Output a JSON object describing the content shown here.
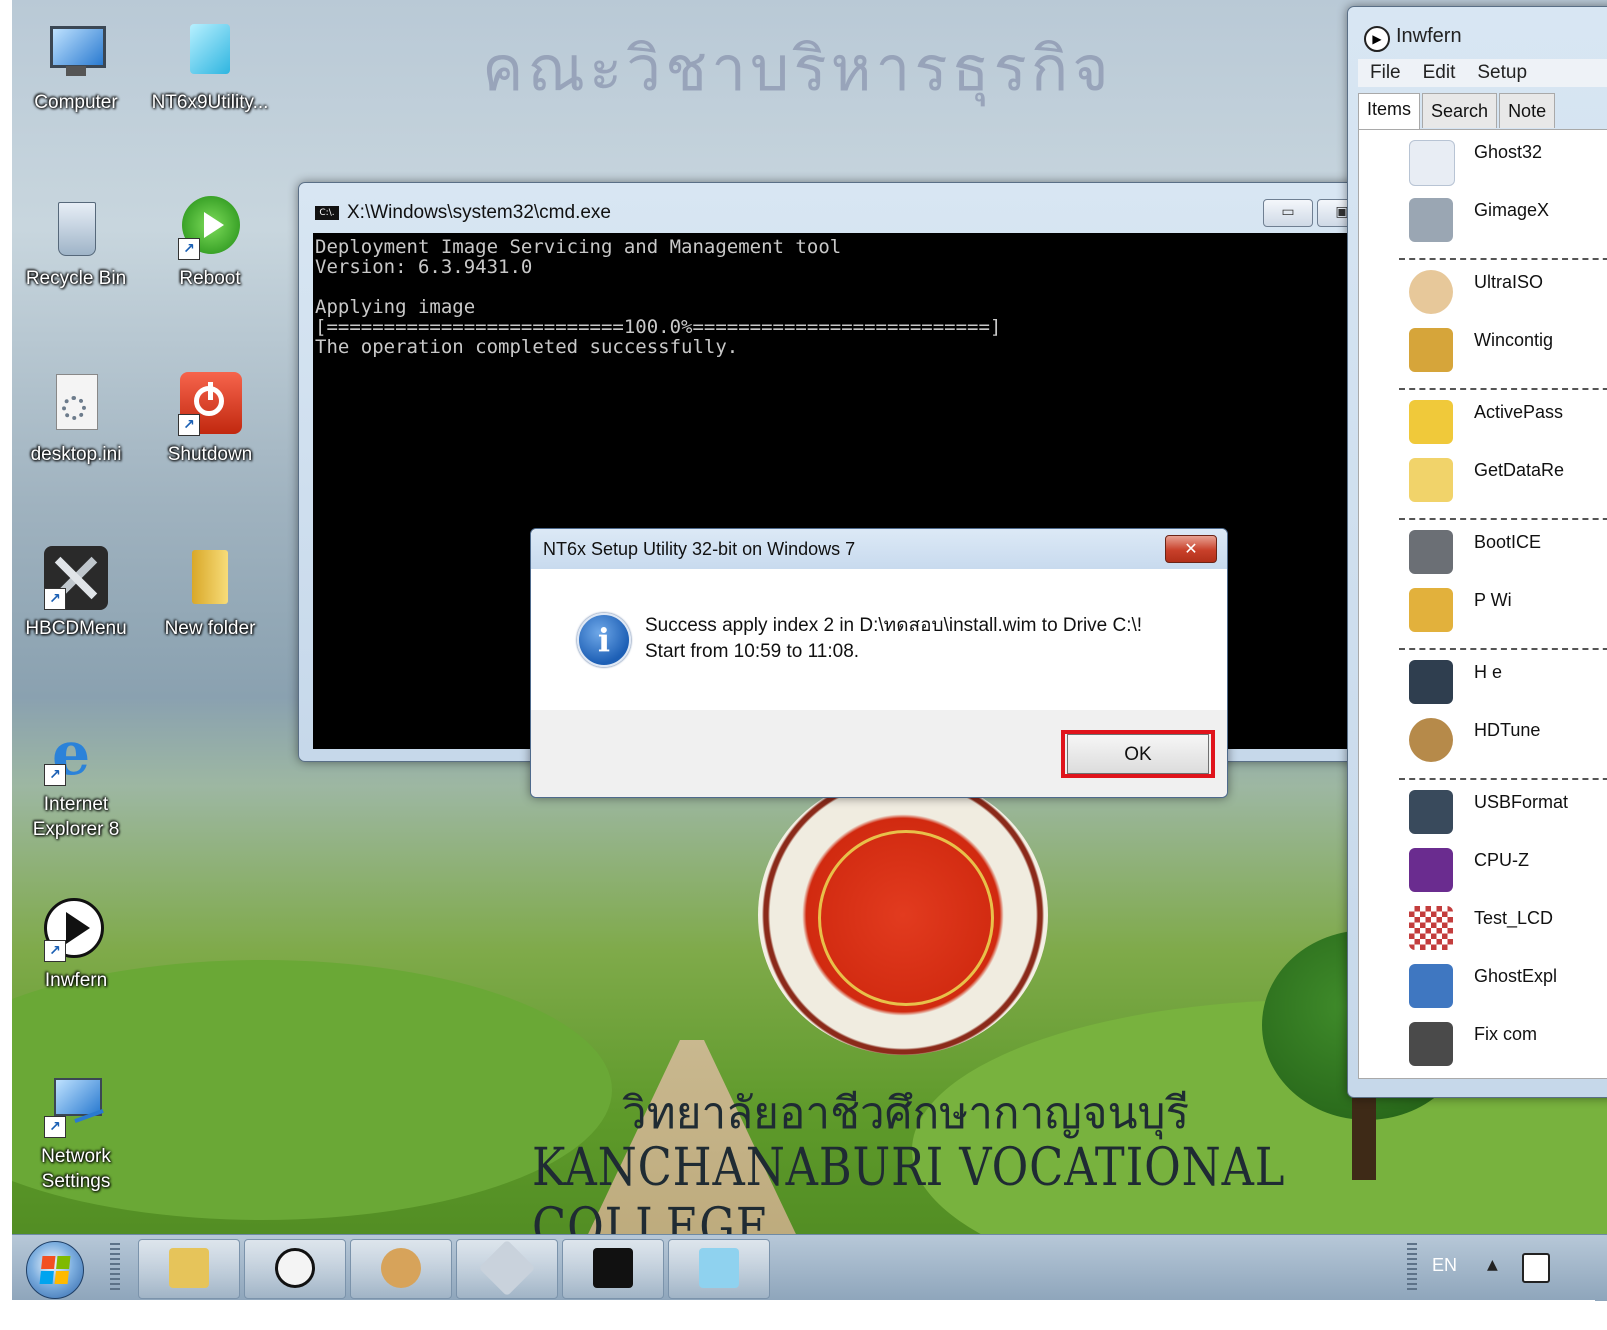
{
  "desktop": {
    "banner_text": "คณะวิชาบริหารธุรกิจ",
    "college_th": "วิทยาลัยอาชีวศึกษากาญจนบุรี",
    "college_en": "KANCHANABURI VOCATIONAL COLLEGE",
    "icons": [
      {
        "label": "Computer",
        "icon": "computer-icon"
      },
      {
        "label": "NT6x9Utility...",
        "icon": "nt6x-utility-icon"
      },
      {
        "label": "Recycle Bin",
        "icon": "recycle-bin-icon"
      },
      {
        "label": "Reboot",
        "icon": "reboot-icon"
      },
      {
        "label": "desktop.ini",
        "icon": "ini-file-icon"
      },
      {
        "label": "Shutdown",
        "icon": "shutdown-icon"
      },
      {
        "label": "HBCDMenu",
        "icon": "tools-icon"
      },
      {
        "label": "New folder",
        "icon": "folder-icon"
      },
      {
        "label": "Internet Explorer 8",
        "icon": "internet-explorer-icon"
      },
      {
        "label": "Inwfern",
        "icon": "play-icon"
      },
      {
        "label": "Network Settings",
        "icon": "network-icon"
      }
    ]
  },
  "cmd_window": {
    "title": "X:\\Windows\\system32\\cmd.exe",
    "app_icon_text": "C:\\.",
    "console_text": "Deployment Image Servicing and Management tool\nVersion: 6.3.9431.0\n\nApplying image\n[==========================100.0%==========================]\nThe operation completed successfully.",
    "minimize_glyph": "▭",
    "maximize_glyph": "▣",
    "close_glyph": "✕"
  },
  "dialog": {
    "title": "NT6x Setup Utility 32-bit on Windows 7",
    "close_glyph": "✕",
    "info_glyph": "i",
    "message_line1": "Success apply index 2 in D:\\ทดสอบ\\install.wim to Drive C:\\!",
    "message_line2": "Start from 10:59 to 11:08.",
    "ok_label": "OK"
  },
  "inwfern": {
    "title": "Inwfern",
    "menu": [
      "File",
      "Edit",
      "Setup"
    ],
    "tabs": [
      "Items",
      "Search",
      "Note"
    ],
    "items": [
      {
        "name": "Ghost32",
        "icon": "ghost-icon",
        "color": "#e8edf4"
      },
      {
        "name": "GimageX",
        "icon": "disk-image-icon",
        "color": "#9aa6b3"
      },
      {
        "name": "UltraISO",
        "icon": "disc-icon",
        "color": "#e7c89a"
      },
      {
        "name": "Wincontig",
        "icon": "defrag-icon",
        "color": "#d6a53a"
      },
      {
        "name": "ActivePass",
        "icon": "key-icon",
        "color": "#f0c93a"
      },
      {
        "name": "GetDataRe",
        "icon": "lock-icon",
        "color": "#f1d36a"
      },
      {
        "name": "BootICE",
        "icon": "boot-disk-icon",
        "color": "#6b6f75"
      },
      {
        "name": "P          Wi",
        "icon": "wizard-icon",
        "color": "#e2b13c"
      },
      {
        "name": "H          e",
        "icon": "hdd-icon",
        "color": "#2f3e4f"
      },
      {
        "name": "HDTune",
        "icon": "hdtune-icon",
        "color": "#b68a4a"
      },
      {
        "name": "USBFormat",
        "icon": "usb-icon",
        "color": "#394a5c"
      },
      {
        "name": "CPU-Z",
        "icon": "cpuz-icon",
        "color": "#6a2c8f"
      },
      {
        "name": "Test_LCD",
        "icon": "lcd-test-icon",
        "color": "#c33d3d"
      },
      {
        "name": "GhostExpl",
        "icon": "ghost-explorer-icon",
        "color": "#3f77c1"
      },
      {
        "name": "Fix com",
        "icon": "gear-icon",
        "color": "#4a4a4a"
      }
    ]
  },
  "taskbar": {
    "language": "EN",
    "tray_up_glyph": "▲",
    "buttons": [
      {
        "icon": "explorer-icon",
        "color": "#e6c45a"
      },
      {
        "icon": "inwfern-play-icon",
        "color": "#f4f4f4"
      },
      {
        "icon": "paint-icon",
        "color": "#d7a35a"
      },
      {
        "icon": "diskette-icon",
        "color": "#c9d2dc"
      },
      {
        "icon": "cmd-icon",
        "color": "#111111"
      },
      {
        "icon": "nt6x-utility-icon",
        "color": "#8fd2ef"
      }
    ]
  }
}
